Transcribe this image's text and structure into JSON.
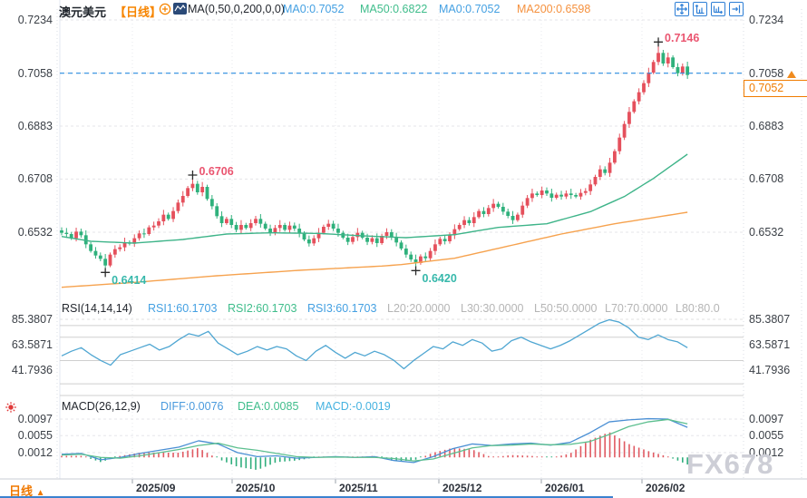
{
  "header": {
    "symbol": "澳元美元",
    "period": "【日线】",
    "ma_function": "MA(0,50,0,200,0,0)",
    "ma_items": [
      {
        "label": "MA0:0.7052",
        "color": "#44a0e2"
      },
      {
        "label": "MA50:0.6822",
        "color": "#3fbd8b"
      },
      {
        "label": "MA0:0.7052",
        "color": "#44a0e2"
      },
      {
        "label": "MA200:0.6598",
        "color": "#f5913e"
      }
    ],
    "toolbar_icons": [
      "pan-icon",
      "scale-vertical-icon",
      "scale-horizontal-icon",
      "go-to-latest-icon"
    ],
    "legend_icons": [
      "plus-circle-icon",
      "mini-chart-icon"
    ]
  },
  "price_axis": {
    "labels": [
      "0.7234",
      "0.7058",
      "0.6883",
      "0.6708",
      "0.6532"
    ],
    "values": [
      0.7234,
      0.7058,
      0.6883,
      0.6708,
      0.6532
    ],
    "current_price": "0.7052",
    "price_line_value": 0.7058,
    "accent_orange": "#f07c00",
    "price_line_blue": "#2a8de0"
  },
  "rsi_panel": {
    "function": "RSI(14,14,14)",
    "items": [
      {
        "label": "RSI1:60.1703",
        "color": "#44a0e2"
      },
      {
        "label": "RSI2:60.1703",
        "color": "#3fbd8b"
      },
      {
        "label": "RSI3:60.1703",
        "color": "#44a0e2"
      }
    ],
    "levels": [
      {
        "label": "L20:20.0000"
      },
      {
        "label": "L30:30.0000"
      },
      {
        "label": "L50:50.0000"
      },
      {
        "label": "L70:70.0000"
      },
      {
        "label": "L80:80.0"
      }
    ],
    "axis_labels": [
      "85.3807",
      "63.5871",
      "41.7936"
    ],
    "axis_values": [
      85.3807,
      63.5871,
      41.7936
    ]
  },
  "macd_panel": {
    "function": "MACD(26,12,9)",
    "items": [
      {
        "label": "DIFF:0.0076",
        "color": "#4a9add"
      },
      {
        "label": "DEA:0.0085",
        "color": "#3fbd8b"
      },
      {
        "label": "MACD:-0.0019",
        "color": "#45b2e0"
      }
    ],
    "axis_labels": [
      "0.0097",
      "0.0055",
      "0.0012"
    ],
    "axis_values": [
      0.0097,
      0.0055,
      0.0012
    ]
  },
  "footer": {
    "tab_label": "日线",
    "dates": [
      "2025/09",
      "2025/10",
      "2025/11",
      "2025/12",
      "2026/01",
      "2026/02"
    ]
  },
  "watermark": "FX678",
  "colors": {
    "up": "#e5505c",
    "down": "#2fb17c",
    "ma50_line": "#3eb489",
    "ma200_line": "#f6a24e",
    "rsi_line": "#4fa6d2",
    "diff_line": "#4a8fd4",
    "dea_line": "#5cbf8f",
    "hist_pos": "#e05a62",
    "hist_neg": "#2fae7d",
    "marker_high": "#ea5570",
    "marker_low": "#36b8ab"
  },
  "chart_data": {
    "type": "candlestick+indicators",
    "title": "澳元美元 日线",
    "x_axis_labels": [
      "2025/09",
      "2025/10",
      "2025/11",
      "2025/12",
      "2026/01",
      "2026/02"
    ],
    "price_axis_range": [
      0.635,
      0.726
    ],
    "candles": {
      "first_open": 0.6538,
      "closes": [
        0.653,
        0.6526,
        0.6512,
        0.6534,
        0.6522,
        0.6492,
        0.647,
        0.6455,
        0.6444,
        0.6422,
        0.6458,
        0.6476,
        0.6482,
        0.6498,
        0.6494,
        0.6512,
        0.6528,
        0.6526,
        0.6548,
        0.6554,
        0.6568,
        0.659,
        0.6576,
        0.6602,
        0.663,
        0.6652,
        0.6678,
        0.6692,
        0.6664,
        0.6682,
        0.6642,
        0.6618,
        0.6585,
        0.6562,
        0.6576,
        0.6556,
        0.654,
        0.6556,
        0.6546,
        0.6562,
        0.6576,
        0.656,
        0.6544,
        0.653,
        0.6546,
        0.6556,
        0.654,
        0.6554,
        0.6544,
        0.6528,
        0.6508,
        0.6495,
        0.6512,
        0.653,
        0.655,
        0.656,
        0.6544,
        0.653,
        0.6514,
        0.65,
        0.6516,
        0.653,
        0.6514,
        0.65,
        0.6512,
        0.6496,
        0.652,
        0.6532,
        0.6514,
        0.6498,
        0.6478,
        0.6458,
        0.6442,
        0.643,
        0.6452,
        0.6446,
        0.647,
        0.6492,
        0.651,
        0.6502,
        0.6522,
        0.6542,
        0.6556,
        0.6572,
        0.6562,
        0.6582,
        0.6602,
        0.6592,
        0.6612,
        0.6626,
        0.6616,
        0.66,
        0.6586,
        0.6572,
        0.659,
        0.662,
        0.6645,
        0.666,
        0.6655,
        0.667,
        0.666,
        0.6646,
        0.6656,
        0.665,
        0.666,
        0.6655,
        0.665,
        0.6662,
        0.6668,
        0.669,
        0.6715,
        0.674,
        0.6728,
        0.6762,
        0.68,
        0.6845,
        0.689,
        0.693,
        0.6965,
        0.6995,
        0.7025,
        0.706,
        0.7095,
        0.7125,
        0.709,
        0.711,
        0.7078,
        0.7058,
        0.708,
        0.7052
      ],
      "extremes": {
        "9": {
          "low": 0.6414
        },
        "27": {
          "high": 0.6706
        },
        "73": {
          "low": 0.642
        },
        "123": {
          "high": 0.7146
        }
      }
    },
    "ma50_anchors": [
      [
        0,
        0.6518
      ],
      [
        6,
        0.6502
      ],
      [
        15,
        0.6496
      ],
      [
        25,
        0.6508
      ],
      [
        34,
        0.6526
      ],
      [
        43,
        0.653
      ],
      [
        53,
        0.6528
      ],
      [
        62,
        0.652
      ],
      [
        71,
        0.6514
      ],
      [
        81,
        0.6524
      ],
      [
        90,
        0.6548
      ],
      [
        100,
        0.656
      ],
      [
        109,
        0.66
      ],
      [
        116,
        0.665
      ],
      [
        122,
        0.671
      ],
      [
        129,
        0.679
      ]
    ],
    "ma200_anchors": [
      [
        0,
        0.635
      ],
      [
        15,
        0.6366
      ],
      [
        32,
        0.6388
      ],
      [
        49,
        0.6406
      ],
      [
        66,
        0.642
      ],
      [
        70,
        0.6425
      ],
      [
        81,
        0.6446
      ],
      [
        92,
        0.6486
      ],
      [
        103,
        0.6526
      ],
      [
        114,
        0.656
      ],
      [
        129,
        0.6598
      ]
    ],
    "rsi": {
      "levels": [
        80,
        70,
        50,
        30,
        20
      ],
      "values": [
        54,
        58,
        61,
        55,
        50,
        46,
        55,
        58,
        61,
        64,
        59,
        62,
        68,
        73,
        71,
        75,
        65,
        60,
        55,
        58,
        62,
        59,
        62,
        60,
        54,
        50,
        58,
        63,
        57,
        52,
        57,
        54,
        58,
        55,
        50,
        43,
        50,
        56,
        62,
        60,
        66,
        63,
        68,
        65,
        58,
        60,
        67,
        70,
        66,
        63,
        60,
        63,
        67,
        72,
        77,
        82,
        85,
        83,
        78,
        70,
        68,
        72,
        68,
        66,
        61
      ]
    },
    "macd": {
      "diff": [
        0.0008,
        0.001,
        -0.0006,
        0.0,
        0.001,
        0.0018,
        0.0026,
        0.0042,
        0.0034,
        0.0012,
        0.0002,
        0.0004,
        -0.0002,
        0.0,
        0.0002,
        0.0,
        0.0002,
        -0.0008,
        -0.0013,
        0.0002,
        0.0022,
        0.0034,
        0.003,
        0.0034,
        0.0036,
        0.0031,
        0.0038,
        0.0062,
        0.009,
        0.0095,
        0.0098,
        0.0097,
        0.0076
      ],
      "dea": [
        0.0006,
        0.0008,
        0.0,
        -0.0002,
        0.0004,
        0.0012,
        0.002,
        0.003,
        0.0036,
        0.0024,
        0.0018,
        0.001,
        0.0002,
        0.0,
        0.0001,
        0.0,
        0.0,
        -0.0003,
        -0.0009,
        -0.0004,
        0.001,
        0.0024,
        0.003,
        0.0031,
        0.0034,
        0.0032,
        0.0033,
        0.004,
        0.0058,
        0.0078,
        0.009,
        0.0096,
        0.0085
      ]
    },
    "markers": [
      {
        "text": "0.7146",
        "candle": 123,
        "pos": "high"
      },
      {
        "text": "0.6706",
        "candle": 27,
        "pos": "high"
      },
      {
        "text": "0.6414",
        "candle": 9,
        "pos": "low"
      },
      {
        "text": "0.6420",
        "candle": 73,
        "pos": "low"
      }
    ]
  }
}
